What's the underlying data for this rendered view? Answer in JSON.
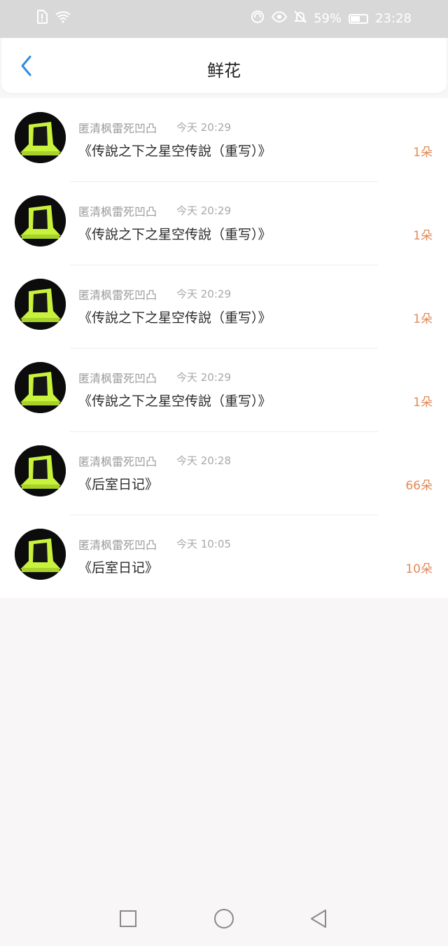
{
  "status_bar": {
    "left_icons": [
      "sim-alert-icon",
      "wifi-icon"
    ],
    "right_icons": [
      "headset-icon",
      "eye-icon",
      "mute-bell-icon"
    ],
    "battery_percent": "59%",
    "battery_level": 0.59,
    "time": "23:28"
  },
  "header": {
    "title": "鲜花",
    "back_icon": "chevron-left-icon",
    "accent_color": "#2f8be0"
  },
  "list": [
    {
      "user": "匿清枫雷死凹凸",
      "time": "今天 20:29",
      "title": "《传說之下之星空传說（重写）》",
      "count": "1朵"
    },
    {
      "user": "匿清枫雷死凹凸",
      "time": "今天 20:29",
      "title": "《传說之下之星空传說（重写）》",
      "count": "1朵"
    },
    {
      "user": "匿清枫雷死凹凸",
      "time": "今天 20:29",
      "title": "《传說之下之星空传說（重写）》",
      "count": "1朵"
    },
    {
      "user": "匿清枫雷死凹凸",
      "time": "今天 20:29",
      "title": "《传說之下之星空传說（重写）》",
      "count": "1朵"
    },
    {
      "user": "匿清枫雷死凹凸",
      "time": "今天 20:28",
      "title": "《后室日记》",
      "count": "66朵"
    },
    {
      "user": "匿清枫雷死凹凸",
      "time": "今天 10:05",
      "title": "《后室日记》",
      "count": "10朵"
    }
  ],
  "nav_bar": {
    "icons": [
      "recent-apps-icon",
      "home-icon",
      "back-icon"
    ]
  },
  "colors": {
    "count": "#e38a57",
    "avatar_green": "#c8f23c"
  }
}
